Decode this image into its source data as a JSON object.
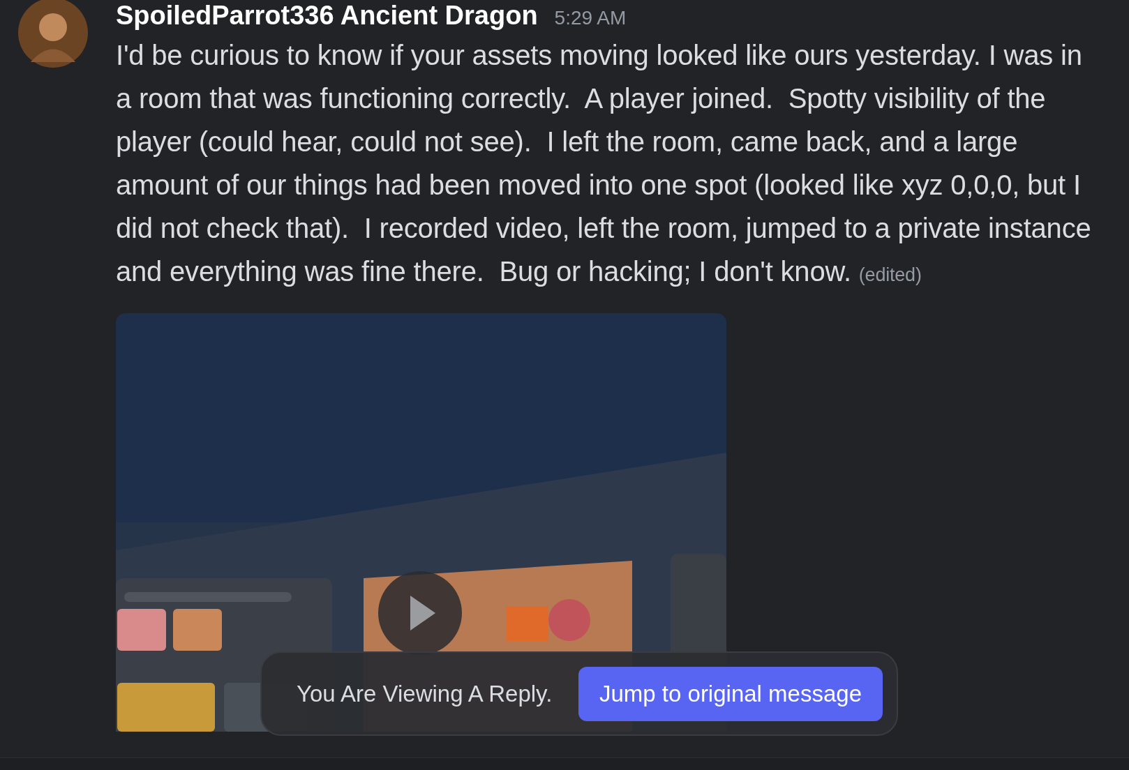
{
  "message": {
    "author": "SpoiledParrot336 Ancient Dragon",
    "timestamp": "5:29 AM",
    "text": "I'd be curious to know if your assets moving looked like ours yesterday. I was in a room that was functioning correctly.  A player joined.  Spotty visibility of the player (could hear, could not see).  I left the room, came back, and a large amount of our things had been moved into one spot (looked like xyz 0,0,0, but I did not check that).  I recorded video, left the room, jumped to a private instance and everything was fine there.  Bug or hacking; I don't know.",
    "edited": "(edited)"
  },
  "reply_bar": {
    "text": "You Are Viewing A Reply.",
    "button": "Jump to original message"
  }
}
